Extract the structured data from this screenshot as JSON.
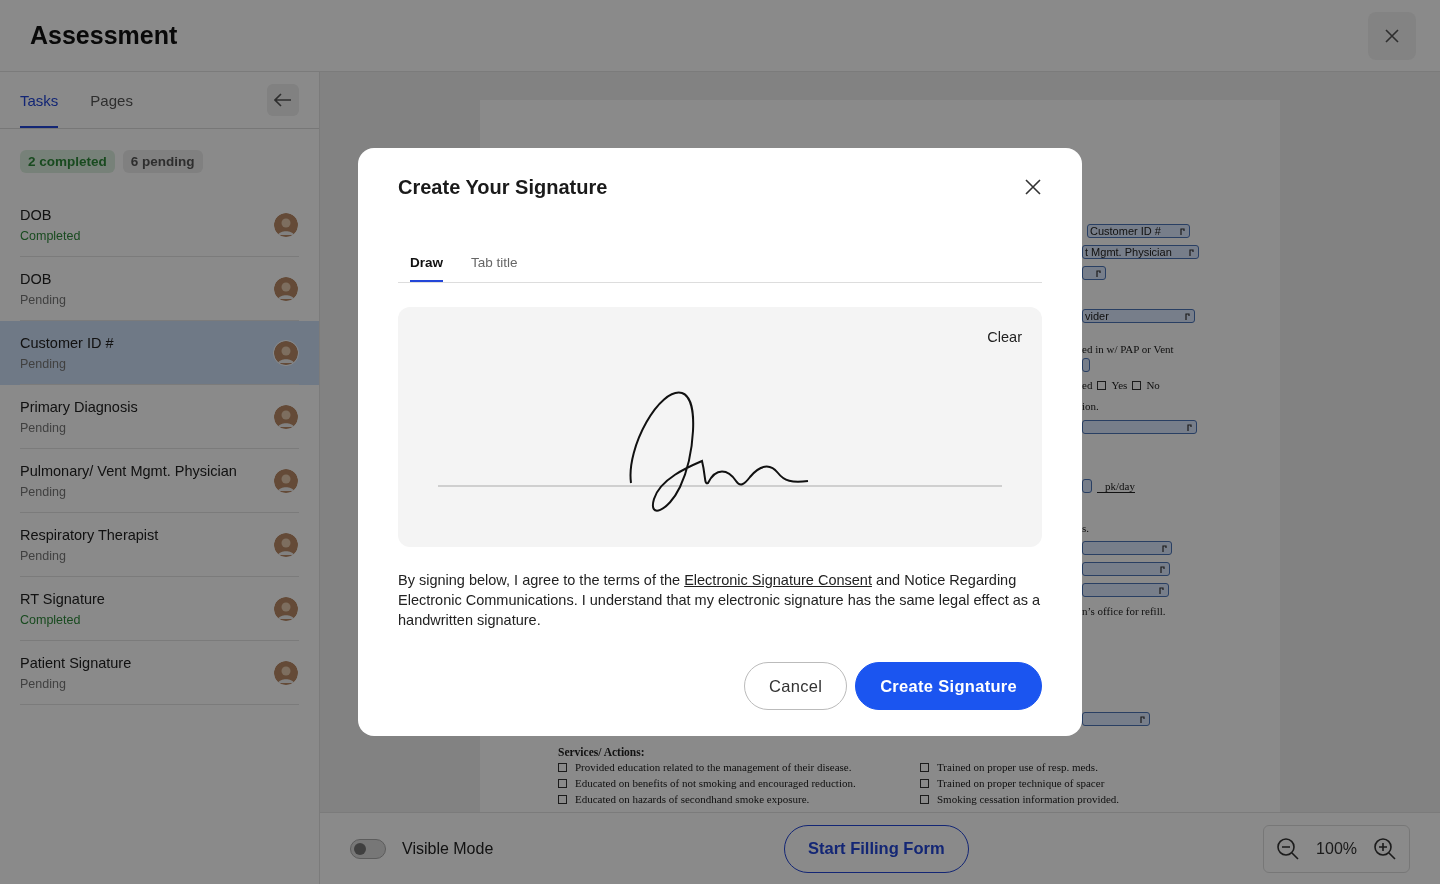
{
  "header": {
    "title": "Assessment"
  },
  "sidebar": {
    "tabs": [
      {
        "label": "Tasks",
        "selected": true
      },
      {
        "label": "Pages",
        "selected": false
      }
    ],
    "summary": [
      {
        "label": "2 completed",
        "kind": "completed"
      },
      {
        "label": "6 pending",
        "kind": "pending"
      }
    ],
    "tasks": [
      {
        "title": "DOB",
        "status": "Completed",
        "kind": "completed",
        "selected": false
      },
      {
        "title": "DOB",
        "status": "Pending",
        "kind": "pending",
        "selected": false
      },
      {
        "title": "Customer ID #",
        "status": "Pending",
        "kind": "pending",
        "selected": true
      },
      {
        "title": "Primary Diagnosis",
        "status": "Pending",
        "kind": "pending",
        "selected": false
      },
      {
        "title": "Pulmonary/ Vent Mgmt. Physician",
        "status": "Pending",
        "kind": "pending",
        "selected": false
      },
      {
        "title": "Respiratory Therapist",
        "status": "Pending",
        "kind": "pending",
        "selected": false
      },
      {
        "title": "RT Signature",
        "status": "Completed",
        "kind": "completed",
        "selected": false
      },
      {
        "title": "Patient Signature",
        "status": "Pending",
        "kind": "pending",
        "selected": false
      }
    ]
  },
  "document": {
    "fragments": [
      {
        "kind": "field",
        "text": "Customer ID #"
      },
      {
        "kind": "field",
        "text": "t Mgmt. Physician"
      },
      {
        "kind": "field"
      },
      {
        "kind": "field",
        "text": "vider"
      },
      {
        "kind": "text",
        "text": "ed in w/ PAP or Vent"
      },
      {
        "kind": "field"
      },
      {
        "kind": "checks",
        "text": "ed",
        "options": [
          {
            "label": "Yes",
            "checked": false
          },
          {
            "label": "No",
            "checked": false
          }
        ]
      },
      {
        "kind": "text",
        "text": "ion."
      },
      {
        "kind": "field"
      },
      {
        "kind": "field",
        "suffix": "pk/day"
      },
      {
        "kind": "text",
        "text": "s."
      },
      {
        "kind": "field"
      },
      {
        "kind": "field"
      },
      {
        "kind": "field"
      },
      {
        "kind": "text",
        "text": "n’s office for refill."
      },
      {
        "kind": "field"
      }
    ],
    "services": {
      "heading": "Services/ Actions:",
      "columns": [
        [
          {
            "label": "Provided education related to the management of their disease.",
            "checked": false
          },
          {
            "label": "Educated on benefits of not smoking and encouraged reduction.",
            "checked": false
          },
          {
            "label": "Educated on hazards of secondhand smoke exposure.",
            "checked": false
          }
        ],
        [
          {
            "label": "Trained on proper use of resp. meds.",
            "checked": false
          },
          {
            "label": "Trained on proper technique of spacer",
            "checked": false
          },
          {
            "label": "Smoking cessation information provided.",
            "checked": false
          }
        ]
      ]
    }
  },
  "bottom_bar": {
    "toggle": {
      "label": "Visible Mode",
      "on": false
    },
    "primary": "Start Filling Form",
    "zoom": "100%"
  },
  "modal": {
    "title": "Create Your Signature",
    "tabs": [
      {
        "label": "Draw",
        "selected": true
      },
      {
        "label": "Tab title",
        "selected": false
      }
    ],
    "clear": "Clear",
    "consent": {
      "before": "By signing below, I agree to the terms of the ",
      "link": "Electronic Signature Consent",
      "after": " and Notice Regarding Electronic Communications. I understand that my electronic signature has the same legal effect as a handwritten signature."
    },
    "buttons": [
      {
        "label": "Cancel",
        "kind": "secondary"
      },
      {
        "label": "Create Signature",
        "kind": "primary"
      }
    ]
  }
}
